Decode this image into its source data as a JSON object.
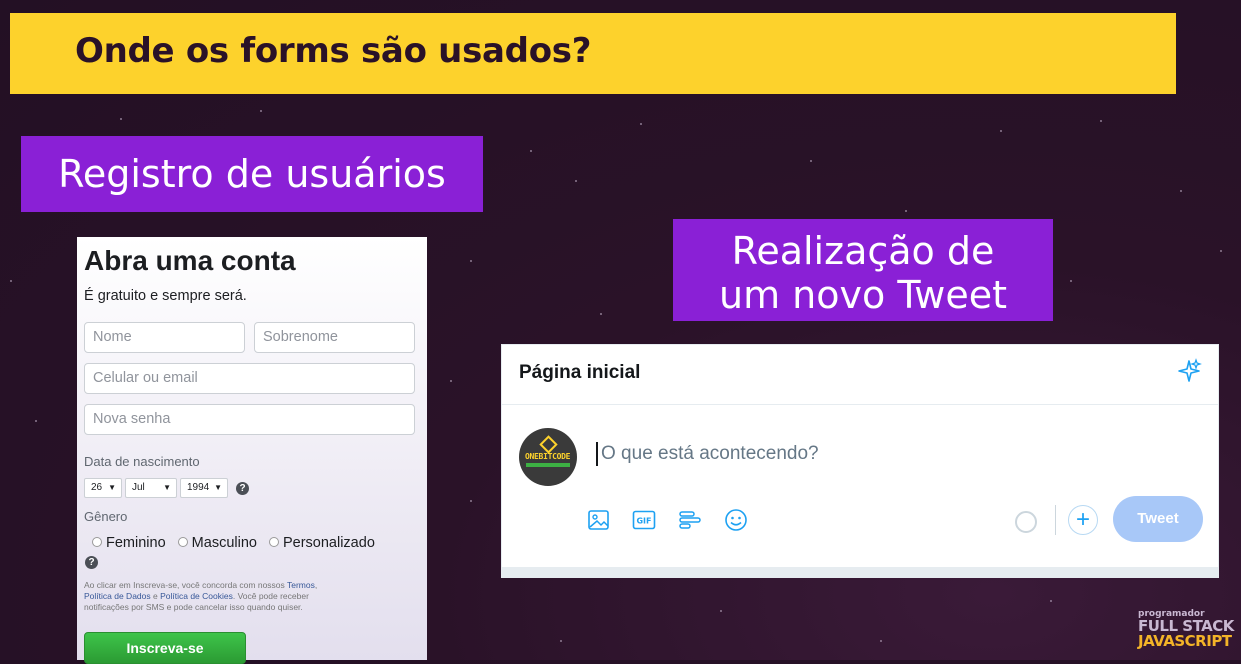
{
  "slide": {
    "title": "Onde os forms são usados?",
    "label_registro": "Registro de usuários",
    "label_tweet_line1": "Realização de",
    "label_tweet_line2": "um novo Tweet"
  },
  "facebook_form": {
    "heading": "Abra uma conta",
    "subheading": "É gratuito e sempre será.",
    "first_name_placeholder": "Nome",
    "last_name_placeholder": "Sobrenome",
    "contact_placeholder": "Celular ou email",
    "password_placeholder": "Nova senha",
    "birthdate_label": "Data de nascimento",
    "day": "26",
    "month": "Jul",
    "year": "1994",
    "gender_label": "Gênero",
    "gender_options": [
      "Feminino",
      "Masculino",
      "Personalizado"
    ],
    "legal_prefix": "Ao clicar em Inscreva-se, você concorda com nossos ",
    "legal_terms": "Termos",
    "legal_mid1": ", ",
    "legal_data_policy": "Política de Dados",
    "legal_mid2": " e ",
    "legal_cookies": "Política de Cookies",
    "legal_suffix": ". Você pode receber notificações por SMS e pode cancelar isso quando quiser.",
    "submit_label": "Inscreva-se"
  },
  "twitter_compose": {
    "header_title": "Página inicial",
    "placeholder": "O que está acontecendo?",
    "avatar_text": "ONEBITCODE",
    "tweet_button": "Tweet",
    "icons": [
      "image-icon",
      "gif-icon",
      "poll-icon",
      "emoji-icon"
    ],
    "accent_color": "#1da1f2"
  },
  "watermark": {
    "line1": "programador",
    "line2": "FULL STACK",
    "line3": "JAVASCRIPT"
  },
  "colors": {
    "title_bar": "#fdd22c",
    "label_bg": "#8a20d6",
    "background": "#2a1228",
    "fb_button": "#36a420"
  }
}
